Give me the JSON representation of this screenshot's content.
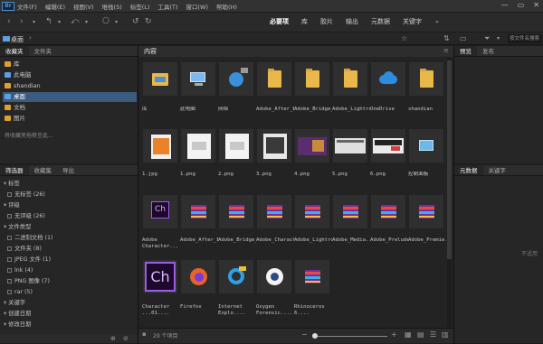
{
  "app": {
    "logo": "Br"
  },
  "menu": [
    "文件(F)",
    "编辑(E)",
    "视图(V)",
    "堆栈(S)",
    "标签(L)",
    "工具(T)",
    "窗口(W)",
    "帮助(H)"
  ],
  "workspaces": [
    "必要项",
    "库",
    "胶片",
    "输出",
    "元数据",
    "关键字"
  ],
  "path": {
    "current": "桌面"
  },
  "search": {
    "placeholder": "按文件名搜索"
  },
  "left_tabs": [
    "收藏夹",
    "文件夹"
  ],
  "favorites": [
    {
      "label": "库",
      "color": "#e0a030"
    },
    {
      "label": "此电脑",
      "color": "#5aa0e8"
    },
    {
      "label": "shandian",
      "color": "#e0a030"
    },
    {
      "label": "桌面",
      "color": "#5aa0e8",
      "selected": true
    },
    {
      "label": "文档",
      "color": "#e0a030"
    },
    {
      "label": "图片",
      "color": "#e0a030"
    }
  ],
  "favorites_hint": "将收藏夹拖移至此...",
  "filter_tabs": [
    "筛选器",
    "收藏集",
    "导出"
  ],
  "filters": [
    {
      "label": "标签",
      "type": "head"
    },
    {
      "label": "无标签  (26)",
      "type": "item"
    },
    {
      "label": "评级",
      "type": "head"
    },
    {
      "label": "无评级  (26)",
      "type": "item"
    },
    {
      "label": "文件类型",
      "type": "head"
    },
    {
      "label": "二进制文档  (1)",
      "type": "item"
    },
    {
      "label": "文件夹  (8)",
      "type": "item"
    },
    {
      "label": "JPEG 文件  (1)",
      "type": "item"
    },
    {
      "label": "lnk  (4)",
      "type": "item"
    },
    {
      "label": "PNG 图像  (7)",
      "type": "item"
    },
    {
      "label": "rar  (5)",
      "type": "item"
    },
    {
      "label": "关键字",
      "type": "head"
    },
    {
      "label": "创建日期",
      "type": "head"
    },
    {
      "label": "修改日期",
      "type": "head"
    }
  ],
  "content_tab": "内容",
  "items": [
    {
      "label": "库",
      "kind": "folder-lib"
    },
    {
      "label": "此电脑",
      "kind": "pc"
    },
    {
      "label": "网络",
      "kind": "network"
    },
    {
      "label": "Adobe_After_Eff....",
      "kind": "folder"
    },
    {
      "label": "Adobe_Bridge_2....",
      "kind": "folder"
    },
    {
      "label": "Adobe_Lightroo....",
      "kind": "folder"
    },
    {
      "label": "OneDrive",
      "kind": "cloud"
    },
    {
      "label": "shandian",
      "kind": "folder"
    },
    {
      "label": "1.jpg",
      "kind": "img-orange"
    },
    {
      "label": "1.png",
      "kind": "img-white"
    },
    {
      "label": "2.png",
      "kind": "img-white"
    },
    {
      "label": "3.png",
      "kind": "img-dark"
    },
    {
      "label": "4.png",
      "kind": "img-purple"
    },
    {
      "label": "5.png",
      "kind": "img-grey"
    },
    {
      "label": "6.png",
      "kind": "img-blue"
    },
    {
      "label": "控制面板",
      "kind": "control"
    },
    {
      "label": "Adobe Character...",
      "kind": "ch-small"
    },
    {
      "label": "Adobe_After_Effe....",
      "kind": "rar"
    },
    {
      "label": "Adobe_Bridge_20....",
      "kind": "rar"
    },
    {
      "label": "Adobe_Character....",
      "kind": "rar"
    },
    {
      "label": "Adobe_Lightro....",
      "kind": "rar"
    },
    {
      "label": "Adobe_Media....",
      "kind": "rar"
    },
    {
      "label": "Adobe_Prelude....",
      "kind": "rar"
    },
    {
      "label": "Adobe_Premie....",
      "kind": "rar"
    },
    {
      "label": "Character ...01....",
      "kind": "ch-big"
    },
    {
      "label": "Firefox",
      "kind": "firefox"
    },
    {
      "label": "Internet Explo....",
      "kind": "ie"
    },
    {
      "label": "Oxygen Forensic....",
      "kind": "oxygen"
    },
    {
      "label": "Rhinoceros 6....",
      "kind": "rar"
    }
  ],
  "status": {
    "count": "29 个项目"
  },
  "right_top_tabs": [
    "预览",
    "发布"
  ],
  "right_bottom_tabs": [
    "元数据",
    "关键字"
  ],
  "meta_empty": "不适用"
}
